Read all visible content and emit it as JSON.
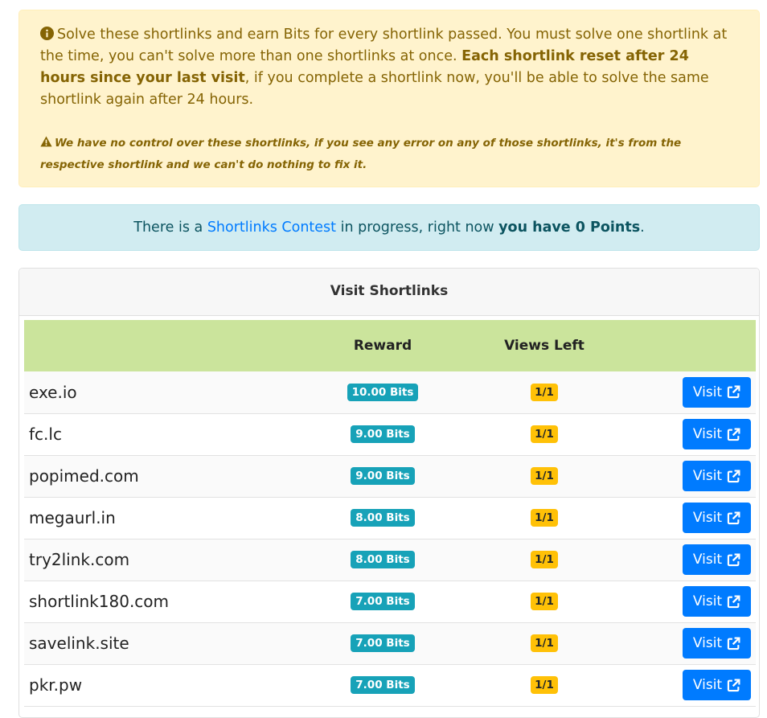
{
  "notice": {
    "text_1": "Solve these shortlinks and earn Bits for every shortlink passed. You must solve one shortlink at the time, you can't solve more than one shortlinks at once. ",
    "bold": "Each shortlink reset after 24 hours since your last visit",
    "text_2": ", if you complete a shortlink now, you'll be able to solve the same shortlink again after 24 hours.",
    "warning": "We have no control over these shortlinks, if you see any error on any of those shortlinks, it's from the respective shortlink and we can't do nothing to fix it."
  },
  "contest": {
    "prefix": "There is a ",
    "link": "Shortlinks Contest",
    "middle": " in progress, right now ",
    "bold": "you have 0 Points",
    "suffix": "."
  },
  "card": {
    "title": "Visit Shortlinks",
    "columns": {
      "name": "",
      "reward": "Reward",
      "views": "Views Left",
      "action": ""
    },
    "rows": [
      {
        "name": "exe.io",
        "reward": "10.00 Bits",
        "views": "1/1",
        "button": "Visit"
      },
      {
        "name": "fc.lc",
        "reward": "9.00 Bits",
        "views": "1/1",
        "button": "Visit"
      },
      {
        "name": "popimed.com",
        "reward": "9.00 Bits",
        "views": "1/1",
        "button": "Visit"
      },
      {
        "name": "megaurl.in",
        "reward": "8.00 Bits",
        "views": "1/1",
        "button": "Visit"
      },
      {
        "name": "try2link.com",
        "reward": "8.00 Bits",
        "views": "1/1",
        "button": "Visit"
      },
      {
        "name": "shortlink180.com",
        "reward": "7.00 Bits",
        "views": "1/1",
        "button": "Visit"
      },
      {
        "name": "savelink.site",
        "reward": "7.00 Bits",
        "views": "1/1",
        "button": "Visit"
      },
      {
        "name": "pkr.pw",
        "reward": "7.00 Bits",
        "views": "1/1",
        "button": "Visit"
      }
    ]
  },
  "colors": {
    "warning_bg": "#fff3cd",
    "warning_text": "#856404",
    "info_bg": "#d1ecf1",
    "header_green": "#cbe49c",
    "bits_badge": "#17a2b8",
    "views_badge": "#ffc107",
    "button": "#007bff"
  },
  "icons": {
    "notice": "info-circle-icon",
    "warning": "exclamation-triangle-icon",
    "visit": "external-link-icon"
  }
}
